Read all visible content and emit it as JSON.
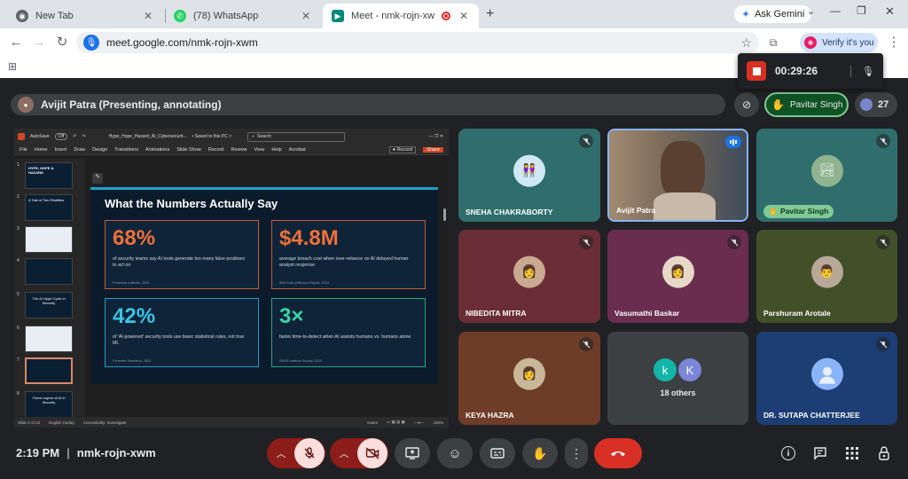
{
  "browser": {
    "tabs": [
      {
        "title": "New Tab",
        "icon": "chrome-icon"
      },
      {
        "title": "(78) WhatsApp",
        "icon": "whatsapp-icon"
      },
      {
        "title": "Meet - nmk-rojn-xwm",
        "icon": "meet-icon"
      }
    ],
    "ask_gemini": "Ask Gemini",
    "url": "meet.google.com/nmk-rojn-xwm",
    "verify_label": "Verify it's you"
  },
  "recording": {
    "elapsed": "00:29:26"
  },
  "meet": {
    "presenter_label": "Avijit Patra (Presenting, annotating)",
    "active_speaker": "Pavitar Singh",
    "participant_count": "27",
    "clock": "2:19 PM",
    "meeting_code": "nmk-rojn-xwm"
  },
  "slide": {
    "title": "What the Numbers Actually Say",
    "stats": [
      {
        "value": "68%",
        "desc": "of security teams say AI tools generate too many false positives to act on",
        "source": "Ponemon Institute, 2023",
        "color": "#f0703a"
      },
      {
        "value": "$4.8M",
        "desc": "average breach cost when over-reliance on AI delayed human analyst response",
        "source": "IBM Cost of Breach Report, 2023",
        "color": "#f0703a"
      },
      {
        "value": "42%",
        "desc": "of 'AI-powered' security tools use basic statistical rules, not true ML",
        "source": "Forrester Research, 2023",
        "color": "#3cc3e8"
      },
      {
        "value": "3×",
        "desc": "faster time-to-detect when AI assists humans vs. humans alone",
        "source": "SANS Institute Survey, 2023",
        "color": "#3cd3a6"
      }
    ]
  },
  "ppt": {
    "autosave": "AutoSave",
    "autosave_state": "Off",
    "filename": "Hype_Hope_Hazard_AI_Cybersecurit...",
    "saved": "• Saved to this PC ˅",
    "search_placeholder": "Search",
    "menu": [
      "File",
      "Home",
      "Insert",
      "Draw",
      "Design",
      "Transitions",
      "Animations",
      "Slide Show",
      "Record",
      "Review",
      "View",
      "Help",
      "Acrobat"
    ],
    "record_btn": "Record",
    "share_btn": "Share",
    "thumb_numbers": [
      "1",
      "2",
      "3",
      "4",
      "5",
      "6",
      "7",
      "8"
    ],
    "thumb_titles": [
      "HYPE, HOPE & HAZARD",
      "A Tale of Two Realities",
      "",
      "",
      "The AI Hype Cycle in Security",
      "",
      "",
      "Three Layers of AI in Security"
    ],
    "status": {
      "slide": "Slide 6 of 23",
      "lang": "English (India)",
      "accessibility": "Accessibility: Investigate",
      "notes": "Notes",
      "zoom": "100%"
    }
  },
  "tiles": [
    {
      "name": "SNEHA CHAKRABORTY",
      "bg": "#2f6e6d",
      "muted": true
    },
    {
      "name": "Avijit Patra",
      "bg": "#6b5a4c",
      "speaking": true
    },
    {
      "name": "Pavitar Singh",
      "bg": "#2f6e6d",
      "muted": true
    },
    {
      "name": "NIBEDITA MITRA",
      "bg": "#6b2d35",
      "muted": true
    },
    {
      "name": "Vasumathi Baskar",
      "bg": "#6a2d50",
      "muted": true
    },
    {
      "name": "Parshuram Arotale",
      "bg": "#42502a",
      "muted": true
    },
    {
      "name": "KEYA HAZRA",
      "bg": "#6e3d28",
      "muted": true
    },
    {
      "name": "18 others",
      "bg": "#3c4043",
      "others": [
        "k",
        "K"
      ]
    },
    {
      "name": "DR. SUTAPA CHATTERJEE",
      "bg": "#1c3e74",
      "muted": true
    }
  ]
}
